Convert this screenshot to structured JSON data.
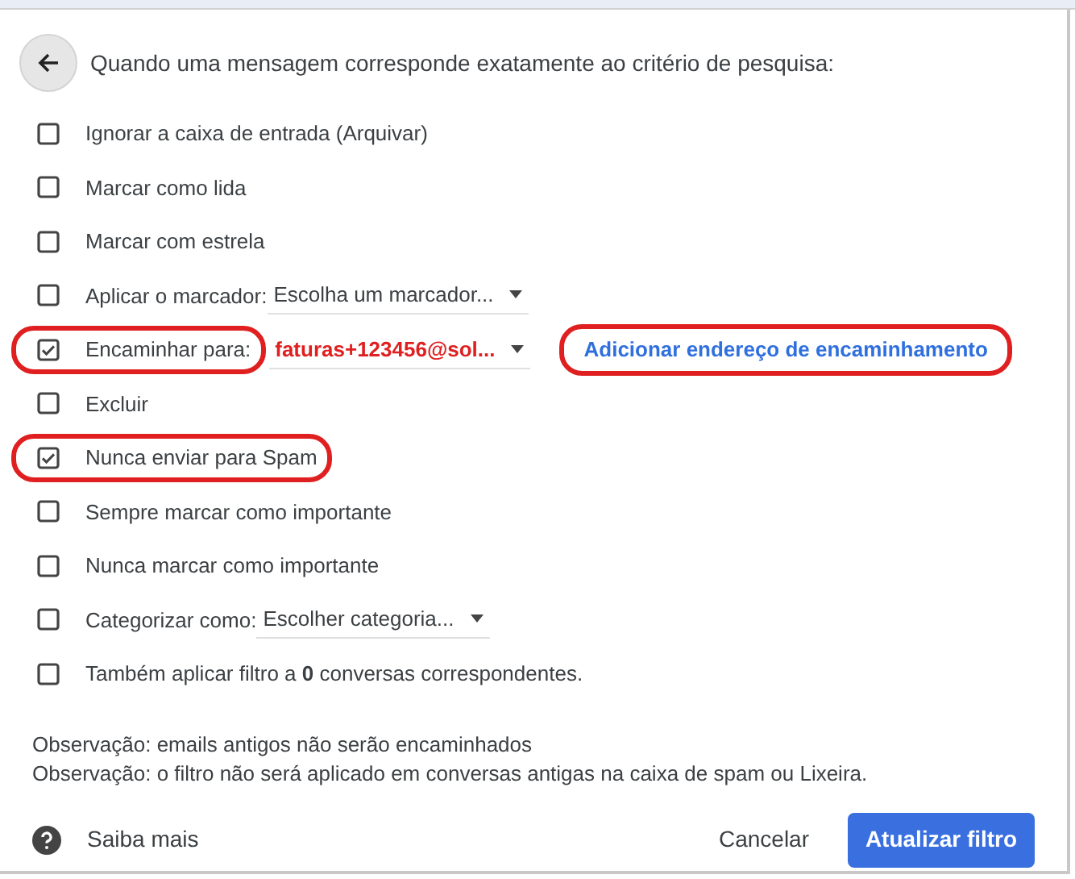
{
  "header": {
    "title": "Quando uma mensagem corresponde exatamente ao critério de pesquisa:"
  },
  "options": [
    {
      "kind": "plain",
      "label": "Ignorar a caixa de entrada (Arquivar)",
      "checked": false,
      "highlighted": false
    },
    {
      "kind": "plain",
      "label": "Marcar como lida",
      "checked": false,
      "highlighted": false
    },
    {
      "kind": "plain",
      "label": "Marcar com estrela",
      "checked": false,
      "highlighted": false
    },
    {
      "kind": "select",
      "label": "Aplicar o marcador:",
      "value": "Escolha um marcador...",
      "checked": false,
      "highlighted": false
    },
    {
      "kind": "forward",
      "label": "Encaminhar para:",
      "value": "faturas+123456@sol...",
      "link": "Adicionar endereço de encaminhamento",
      "link_highlighted": true,
      "checked": true,
      "highlighted": true
    },
    {
      "kind": "plain",
      "label": "Excluir",
      "checked": false,
      "highlighted": false
    },
    {
      "kind": "plain",
      "label": "Nunca enviar para Spam",
      "checked": true,
      "highlighted": true
    },
    {
      "kind": "plain",
      "label": "Sempre marcar como importante",
      "checked": false,
      "highlighted": false
    },
    {
      "kind": "plain",
      "label": "Nunca marcar como importante",
      "checked": false,
      "highlighted": false
    },
    {
      "kind": "select",
      "label": "Categorizar como:",
      "value": "Escolher categoria...",
      "checked": false,
      "highlighted": false
    },
    {
      "kind": "plain",
      "label": "Também aplicar filtro a **0** conversas correspondentes.",
      "checked": false,
      "highlighted": false
    }
  ],
  "notes": [
    "Observação: emails antigos não serão encaminhados",
    "Observação: o filtro não será aplicado em conversas antigas na caixa de spam ou Lixeira."
  ],
  "footer": {
    "help": "Saiba mais",
    "cancel": "Cancelar",
    "submit": "Atualizar filtro"
  }
}
